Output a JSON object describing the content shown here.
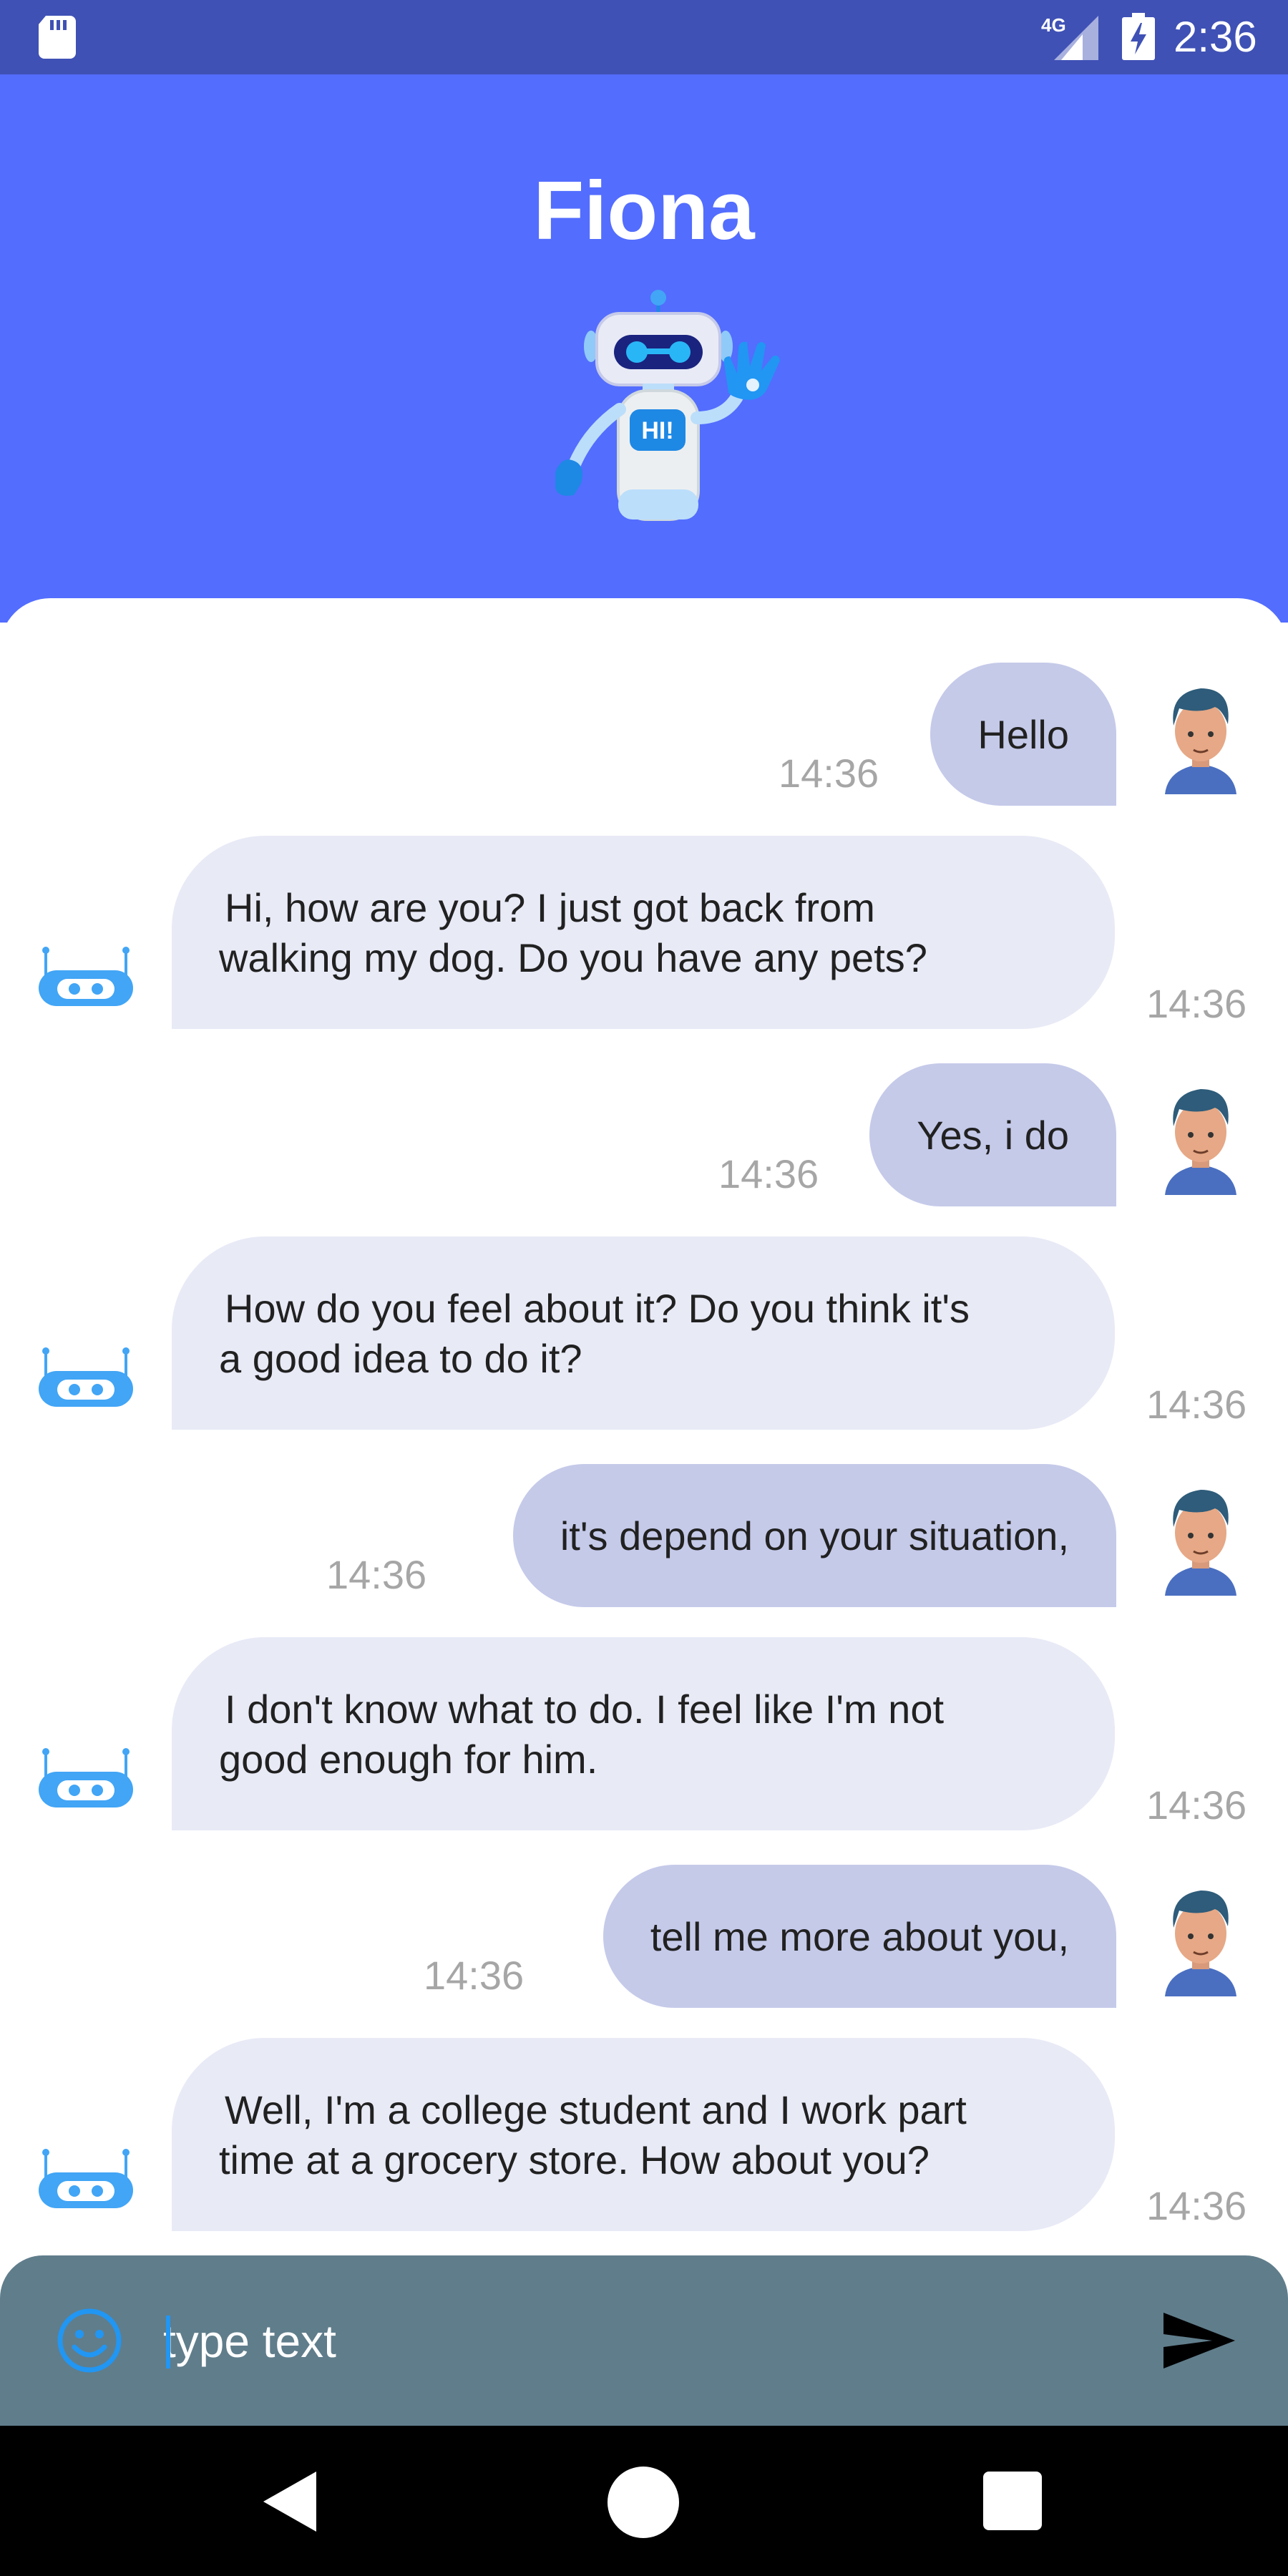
{
  "status_bar": {
    "network_label": "4G",
    "time": "2:36"
  },
  "header": {
    "title": "Fiona",
    "robot_badge": "HI!"
  },
  "messages": [
    {
      "sender": "user",
      "text": "Hello",
      "time": "14:36"
    },
    {
      "sender": "bot",
      "line1": "Hi, how are you? I just got back from",
      "line2": "walking my dog. Do you have any pets?",
      "time": "14:36"
    },
    {
      "sender": "user",
      "text": "Yes, i do",
      "time": "14:36"
    },
    {
      "sender": "bot",
      "line1": "How do you feel about it? Do you think it's",
      "line2": "a good idea to do it?",
      "time": "14:36"
    },
    {
      "sender": "user",
      "text": "it's depend on your situation,",
      "time": "14:36"
    },
    {
      "sender": "bot",
      "line1": "I don't know what to do. I feel like I'm not",
      "line2": "good enough for him.",
      "time": "14:36"
    },
    {
      "sender": "user",
      "text": "tell me more about you,",
      "time": "14:36"
    },
    {
      "sender": "bot",
      "line1": "Well, I'm a college student and I work part",
      "line2": "time at a grocery store. How about you?",
      "time": "14:36"
    }
  ],
  "input": {
    "placeholder": "type text",
    "value": ""
  },
  "colors": {
    "status_bar": "#3f51b5",
    "header": "#536dfe",
    "user_bubble": "#c5cae9",
    "bot_bubble": "#e8eaf6",
    "input_bar": "#607d8b",
    "accent": "#2196f3"
  },
  "icons": [
    "sd-card-icon",
    "signal-icon",
    "battery-charging-icon",
    "robot-waving-icon",
    "user-avatar-icon",
    "robot-head-icon",
    "emoji-icon",
    "send-icon",
    "back-icon",
    "home-icon",
    "recents-icon"
  ]
}
